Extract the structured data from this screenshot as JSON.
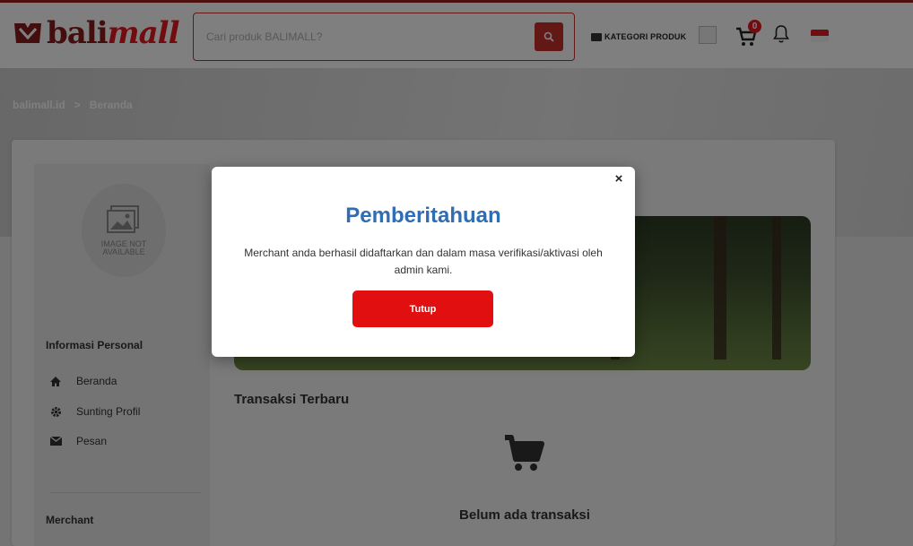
{
  "header": {
    "logo_text_1": "bali",
    "logo_text_2": "mall",
    "search_placeholder": "Cari produk BALIMALL?",
    "kategori_label": "KATEGORI PRODUK",
    "cart_count": "0"
  },
  "breadcrumb": {
    "items": [
      "balimall.id",
      ">",
      "Beranda"
    ]
  },
  "avatar": {
    "line1": "IMAGE NOT",
    "line2": "AVAILABLE"
  },
  "sidebar": {
    "section_personal": "Informasi Personal",
    "items": [
      {
        "label": "Beranda",
        "icon": "home-icon"
      },
      {
        "label": "Sunting Profil",
        "icon": "gear-icon"
      },
      {
        "label": "Pesan",
        "icon": "envelope-icon"
      }
    ],
    "section_merchant": "Merchant"
  },
  "main": {
    "section_title": "Transaksi Terbaru",
    "empty_text": "Belum ada transaksi"
  },
  "modal": {
    "title": "Pemberitahuan",
    "message": "Merchant anda berhasil didaftarkan dan dalam masa verifikasi/aktivasi oleh admin kami.",
    "button_label": "Tutup",
    "close_glyph": "×"
  },
  "colors": {
    "brand_dark": "#8b1d1d",
    "brand_red": "#e31b23",
    "title_blue": "#2f6db5",
    "button_red": "#e10f0f"
  }
}
